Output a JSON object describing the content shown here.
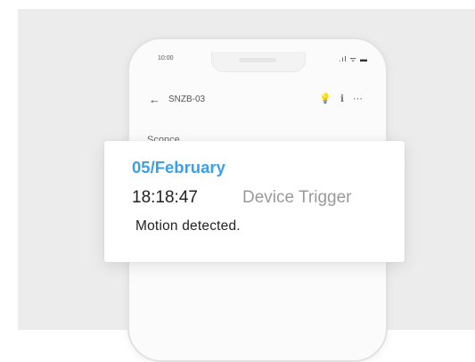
{
  "phone": {
    "status_time": "10:00",
    "status_icons": ".ıl ᯤ ▬",
    "title": "SNZB-03",
    "back_icon": "←",
    "nav_icons": [
      "💡",
      "ℹ",
      "⋯"
    ],
    "section_label": "Sconce"
  },
  "notification": {
    "date": "05/February",
    "time": "18:18:47",
    "trigger": "Device Trigger",
    "message": "Motion detected."
  },
  "colors": {
    "accent": "#3aa0e8",
    "muted": "#9a9a9a"
  }
}
